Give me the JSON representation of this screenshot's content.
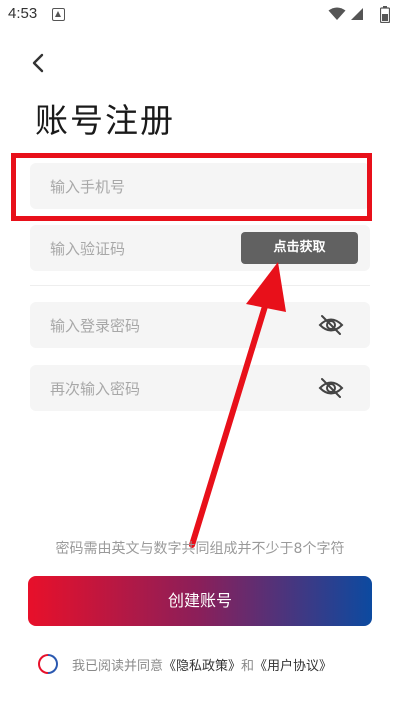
{
  "status_bar": {
    "time": "4:53",
    "icons": [
      "notification-icon",
      "wifi-icon",
      "signal-icon",
      "battery-icon"
    ]
  },
  "header": {
    "back_icon": "chevron-left-icon",
    "title": "账号注册"
  },
  "form": {
    "phone_placeholder": "输入手机号",
    "code_placeholder": "输入验证码",
    "get_code_label": "点击获取",
    "password_placeholder": "输入登录密码",
    "confirm_password_placeholder": "再次输入密码",
    "visibility_icon": "eye-off-icon"
  },
  "hint": "密码需由英文与数字共同组成并不少于8个字符",
  "create_button_label": "创建账号",
  "agreement": {
    "prefix": "我已阅读并同意",
    "privacy_link": "《隐私政策》",
    "conjunction": "和",
    "user_link": "《用户协议》"
  },
  "colors": {
    "annotation_red": "#e8101a",
    "button_gradient_start": "#e8102a",
    "button_gradient_end": "#0c4aa0",
    "code_button_bg": "#616161"
  }
}
